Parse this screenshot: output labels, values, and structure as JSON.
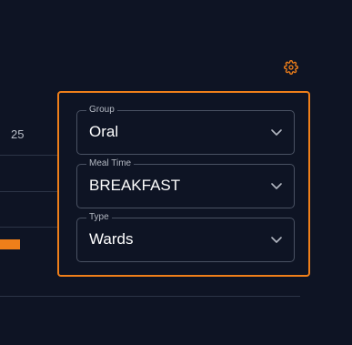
{
  "background": {
    "cell_value": "25"
  },
  "settings": {
    "icon": "gear-icon",
    "color": "#ef7f1a"
  },
  "filters": {
    "group": {
      "label": "Group",
      "value": "Oral"
    },
    "meal_time": {
      "label": "Meal Time",
      "value": "BREAKFAST"
    },
    "type": {
      "label": "Type",
      "value": "Wards"
    }
  },
  "colors": {
    "accent": "#ef7f1a",
    "background": "#0e1424",
    "text": "#ffffff"
  }
}
